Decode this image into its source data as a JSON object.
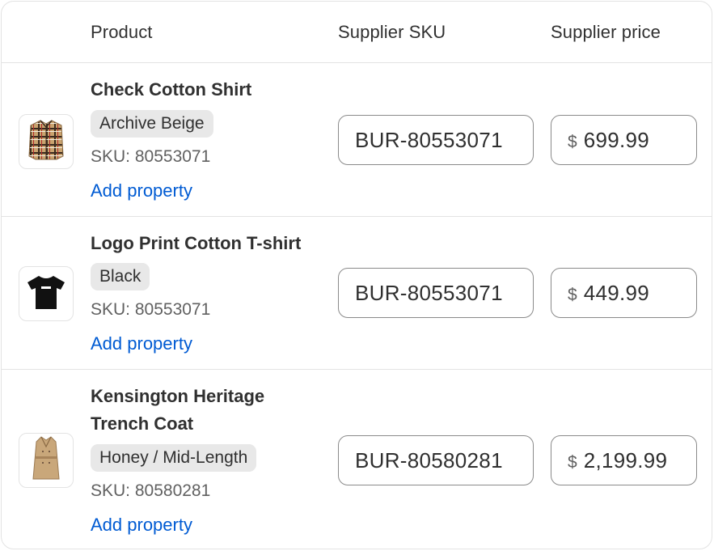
{
  "header": {
    "product": "Product",
    "supplier_sku": "Supplier SKU",
    "supplier_price": "Supplier price"
  },
  "colors": {
    "border": "#e3e3e3",
    "input_border": "#8a8a8a",
    "link": "#005bd3",
    "badge_bg": "#e8e8e8",
    "text": "#303030",
    "muted": "#616161"
  },
  "rows": [
    {
      "thumb_icon": "check-shirt-icon",
      "name_line1": "Check Cotton Shirt",
      "name_line2": "",
      "variant": "Archive Beige",
      "sku_label": "SKU: 80553071",
      "add_property": "Add property",
      "supplier_sku_value": "BUR-80553071",
      "currency": "$",
      "price": "699.99"
    },
    {
      "thumb_icon": "black-tshirt-icon",
      "name_line1": "Logo Print Cotton T-shirt",
      "name_line2": "",
      "variant": "Black",
      "sku_label": "SKU: 80553071",
      "add_property": "Add property",
      "supplier_sku_value": "BUR-80553071",
      "currency": "$",
      "price": "449.99"
    },
    {
      "thumb_icon": "trench-coat-icon",
      "name_line1": "Kensington Heritage",
      "name_line2": "Trench Coat",
      "variant": "Honey / Mid-Length",
      "sku_label": "SKU: 80580281",
      "add_property": "Add property",
      "supplier_sku_value": "BUR-80580281",
      "currency": "$",
      "price": "2,199.99"
    }
  ]
}
